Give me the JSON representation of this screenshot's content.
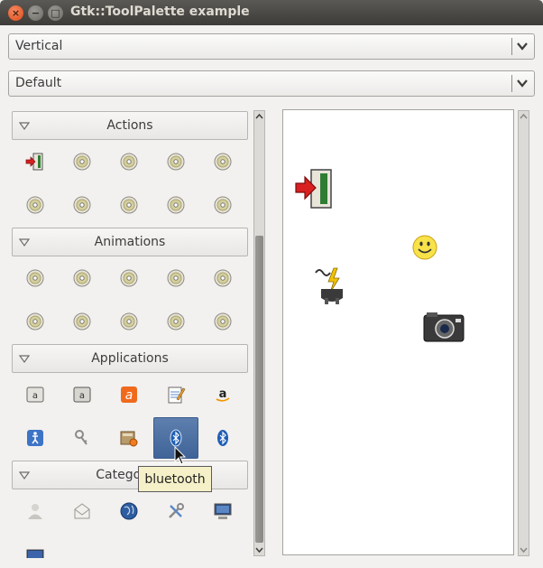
{
  "window": {
    "title": "Gtk::ToolPalette example",
    "close_glyph": "×",
    "min_glyph": "−",
    "max_glyph": "□"
  },
  "orientation_combo": {
    "value": "Vertical",
    "icon": "chevron-down-icon"
  },
  "style_combo": {
    "value": "Default",
    "icon": "chevron-down-icon"
  },
  "palette": {
    "groups": [
      {
        "label": "Actions",
        "tools": [
          "exit-icon",
          "cd-icon",
          "cd-icon",
          "cd-icon",
          "cd-icon",
          "cd-icon",
          "cd-icon",
          "cd-icon",
          "cd-icon",
          "cd-icon"
        ]
      },
      {
        "label": "Animations",
        "tools": [
          "cd-icon",
          "cd-icon",
          "cd-icon",
          "cd-icon",
          "cd-icon",
          "cd-icon",
          "cd-icon",
          "cd-icon",
          "cd-icon",
          "cd-icon"
        ]
      },
      {
        "label": "Applications",
        "tools": [
          "font-viewer-icon",
          "font-viewer-icon",
          "orange-a-icon",
          "notepad-icon",
          "amazon-icon",
          "accessibility-icon",
          "keyring-icon",
          "file-roller-icon",
          "bluetooth-icon",
          "bluetooth-icon"
        ]
      },
      {
        "label": "Categories",
        "tools": [
          "user-icon",
          "mail-icon",
          "globe-icon",
          "tools-icon",
          "computer-icon",
          "monitor-icon"
        ]
      }
    ],
    "hovered_tool": "bluetooth"
  },
  "tooltip": {
    "text": "bluetooth"
  },
  "drop_area": {
    "items": [
      "exit-icon",
      "smiley-icon",
      "power-plug-icon",
      "camera-icon"
    ]
  }
}
